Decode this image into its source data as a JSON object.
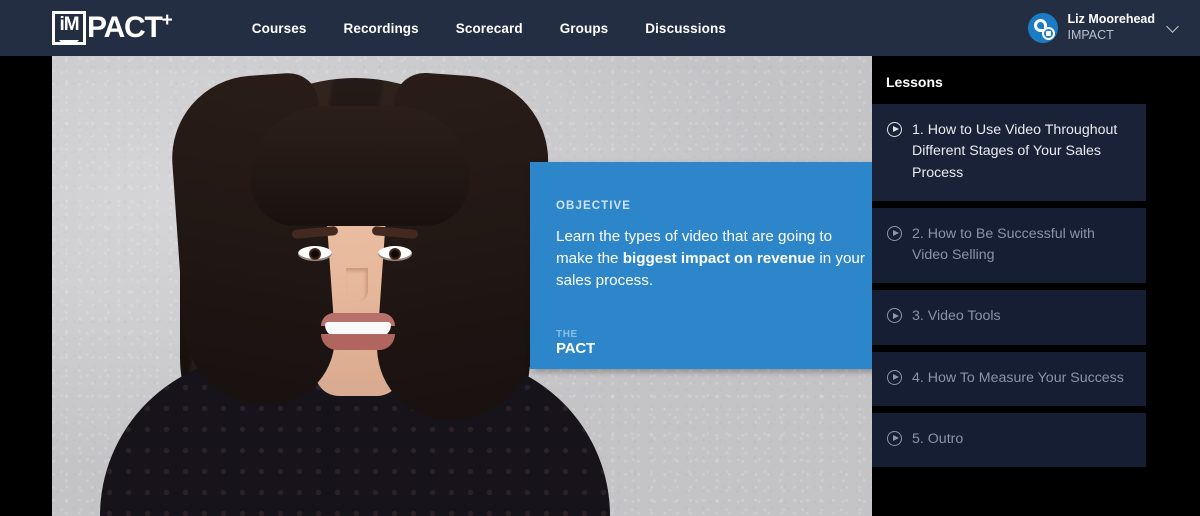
{
  "header": {
    "logo": {
      "badge_text": "iM",
      "word": "PACT",
      "plus": "+",
      "alt": "IMPACT+"
    },
    "nav": [
      {
        "label": "Courses"
      },
      {
        "label": "Recordings"
      },
      {
        "label": "Scorecard"
      },
      {
        "label": "Groups"
      },
      {
        "label": "Discussions"
      }
    ],
    "user": {
      "name": "Liz Moorehead",
      "organization": "IMPACT",
      "avatar_icon": "impact-logo-avatar",
      "chevron_icon": "chevron-down-icon"
    },
    "background_color": "#242e42"
  },
  "video": {
    "scene_description": "Woman with long dark wavy hair smiling at camera in front of a light gray wall",
    "overlay_card": {
      "label": "OBJECTIVE",
      "text_before": "Learn the types of video that are going to make the ",
      "text_bold": "biggest impact on revenue",
      "text_after": " in your sales process.",
      "brand_line_1": "THE",
      "brand_line_2": "PACT",
      "background_color": "#2d86ca"
    }
  },
  "sidebar": {
    "title": "Lessons",
    "background_color": "#000000",
    "item_background_color": "#161e33",
    "active_item_background_color": "#1a2238",
    "lessons": [
      {
        "label": "1. How to Use Video Throughout Different Stages of Your Sales Process",
        "icon": "play-circle-icon",
        "active": true
      },
      {
        "label": "2. How to Be Successful with Video Selling",
        "icon": "play-circle-icon",
        "active": false
      },
      {
        "label": "3. Video Tools",
        "icon": "play-circle-icon",
        "active": false
      },
      {
        "label": "4. How To Measure Your Success",
        "icon": "play-circle-icon",
        "active": false
      },
      {
        "label": "5. Outro",
        "icon": "play-circle-icon",
        "active": false
      }
    ]
  }
}
